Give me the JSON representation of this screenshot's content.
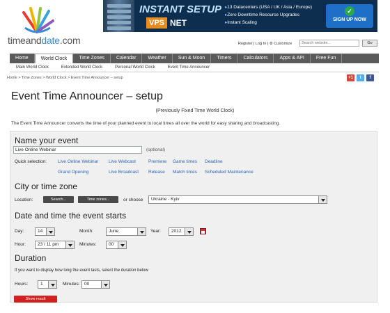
{
  "site": {
    "logo_part1": "timeand",
    "logo_part2": "date",
    "logo_part3": ".com"
  },
  "ad": {
    "title": "INSTANT SETUP",
    "vps": "VPS",
    "net": "NET",
    "bullets": [
      "13 Datacenters (USA / UK / Asia / Europe)",
      "Zero Downtime Resource Upgrades",
      "Instant Scaling"
    ],
    "cta": "SIGN UP NOW"
  },
  "header": {
    "toplinks": "Register | Log In | ⚙ Customize",
    "search_placeholder": "Search website...",
    "go": "Go"
  },
  "nav": [
    "Home",
    "World Clock",
    "Time Zones",
    "Calendar",
    "Weather",
    "Sun & Moon",
    "Timers",
    "Calculators",
    "Apps & API",
    "Free Fun"
  ],
  "subnav": [
    "Main World Clock",
    "Extended World Clock",
    "Personal World Clock",
    "Event Time Announcer"
  ],
  "breadcrumb": "Home > Time Zones > World Clock > Event Time Announcer – setup",
  "social": {
    "gplus": "+1"
  },
  "page": {
    "title": "Event Time Announcer – setup",
    "subtitle": "(Previously Fixed Time World Clock)",
    "intro": "The Event Time Announcer converts the time of your planned event to local times all over the world for easy sharing and broadcasting."
  },
  "form": {
    "event": {
      "heading": "Name your event",
      "value": "Live Online Webinar",
      "optional": "(optional)",
      "quick_label": "Quick selection:",
      "quick_row1": [
        "Live Online Webinar",
        "Live Webcast",
        "Premiere",
        "Game times",
        "Deadline"
      ],
      "quick_row2": [
        "Grand Opening",
        "Live Broadcast",
        "Release",
        "Match times",
        "Scheduled Maintenance"
      ]
    },
    "city": {
      "heading": "City or time zone",
      "location_label": "Location:",
      "search_btn": "Search...",
      "tz_btn": "Time zones...",
      "or_choose": "or choose",
      "selected": "Ukraine - Kyiv"
    },
    "date": {
      "heading": "Date and time the event starts",
      "day_label": "Day:",
      "day": "14",
      "month_label": "Month:",
      "month": "June",
      "year_label": "Year:",
      "year": "2012",
      "hour_label": "Hour:",
      "hour": "23 / 11 pm",
      "minutes_label": "Minutes:",
      "minutes": "00"
    },
    "duration": {
      "heading": "Duration",
      "hint": "If you want to display how long the event lasts, select the duration below",
      "hours_label": "Hours:",
      "hours": "1",
      "minutes_label": "Minutes:",
      "minutes": "00"
    },
    "submit": "Show result"
  }
}
